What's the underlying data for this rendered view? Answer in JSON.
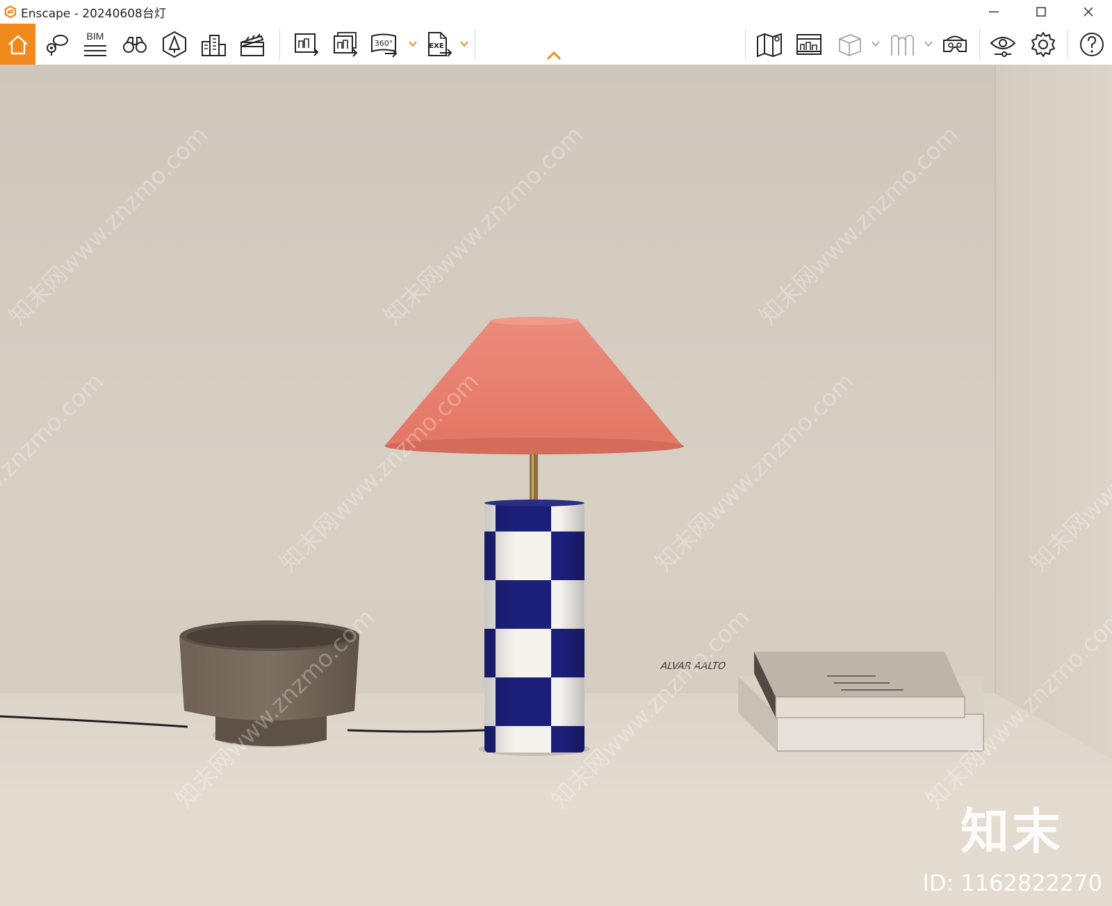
{
  "window": {
    "app_name": "Enscape",
    "title": "Enscape - 20240608台灯"
  },
  "toolbar": {
    "bim_label": "BIM",
    "panorama_label": "360°",
    "exe_label": "EXE",
    "accent_color": "#f18a1c"
  },
  "viewport": {
    "watermark_text": "知末网www.znzmo.com",
    "brand_text": "知末",
    "id_text": "ID: 1162822270",
    "book_title": "ALVAR AALTO"
  },
  "icons": [
    "home-icon",
    "location-comment-icon",
    "bim-icon",
    "binoculars-icon",
    "perspective-icon",
    "buildings-icon",
    "clapperboard-icon",
    "render-image-icon",
    "batch-render-icon",
    "panorama-360-icon",
    "export-exe-icon",
    "map-icon",
    "asset-library-icon",
    "cube-icon",
    "material-icon",
    "vr-headset-icon",
    "visual-settings-icon",
    "settings-gear-icon",
    "help-icon"
  ]
}
